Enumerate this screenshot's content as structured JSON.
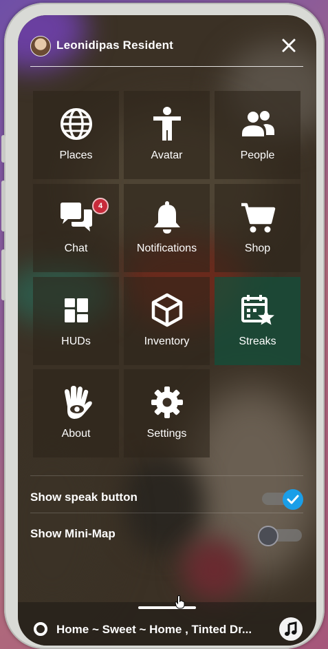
{
  "header": {
    "username": "Leonidipas Resident",
    "avatar_icon": "profile-avatar",
    "close_icon": "close-icon"
  },
  "menu": {
    "tiles": [
      {
        "label": "Places",
        "icon": "globe-icon"
      },
      {
        "label": "Avatar",
        "icon": "person-icon"
      },
      {
        "label": "People",
        "icon": "people-icon"
      },
      {
        "label": "Chat",
        "icon": "chat-icon",
        "badge": "4"
      },
      {
        "label": "Notifications",
        "icon": "bell-icon"
      },
      {
        "label": "Shop",
        "icon": "cart-icon"
      },
      {
        "label": "HUDs",
        "icon": "grid-icon"
      },
      {
        "label": "Inventory",
        "icon": "box-icon"
      },
      {
        "label": "Streaks",
        "icon": "calendar-star-icon"
      },
      {
        "label": "About",
        "icon": "hand-eye-icon"
      },
      {
        "label": "Settings",
        "icon": "gear-icon"
      }
    ]
  },
  "settings": {
    "show_speak_button": {
      "label": "Show speak button",
      "checked": true
    },
    "show_mini_map": {
      "label": "Show Mini-Map",
      "checked": false
    }
  },
  "location": {
    "text": "Home ~ Sweet ~ Home , Tinted Dr...",
    "pin_icon": "location-pin-icon",
    "music_icon": "music-note-icon"
  },
  "colors": {
    "accent": "#1a9ee8",
    "badge": "#c72a3a",
    "streaks_tile": "#10503c"
  }
}
